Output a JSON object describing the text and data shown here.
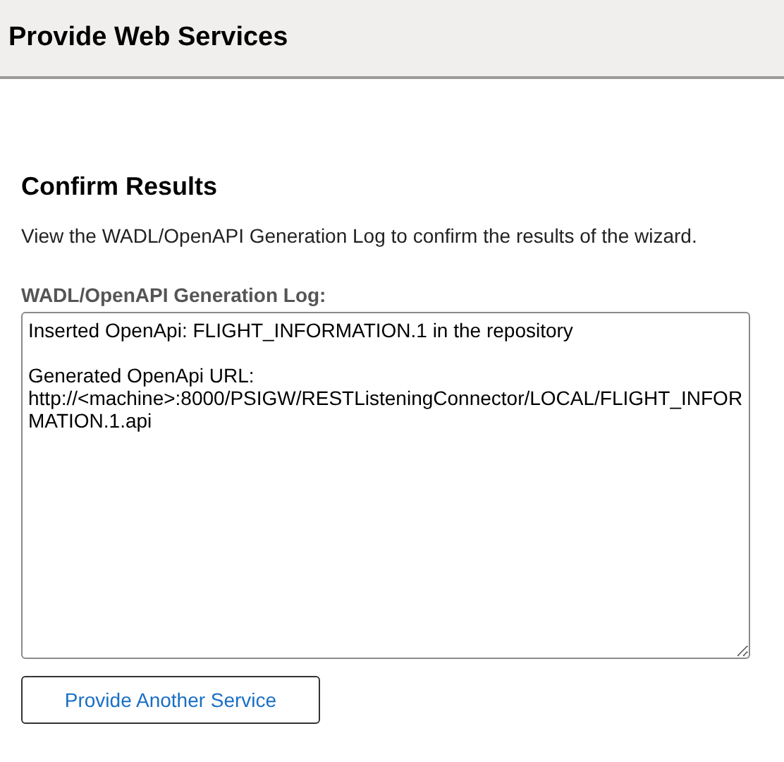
{
  "header": {
    "title": "Provide Web Services"
  },
  "section": {
    "title": "Confirm Results",
    "description": "View the WADL/OpenAPI Generation Log to confirm the results of the wizard."
  },
  "log": {
    "label": "WADL/OpenAPI Generation Log:",
    "value": "Inserted OpenApi: FLIGHT_INFORMATION.1 in the repository\n\nGenerated OpenApi URL:\nhttp://<machine>:8000/PSIGW/RESTListeningConnector/LOCAL/FLIGHT_INFORMATION.1.api"
  },
  "buttons": [
    {
      "label": "Provide Another Service"
    }
  ]
}
